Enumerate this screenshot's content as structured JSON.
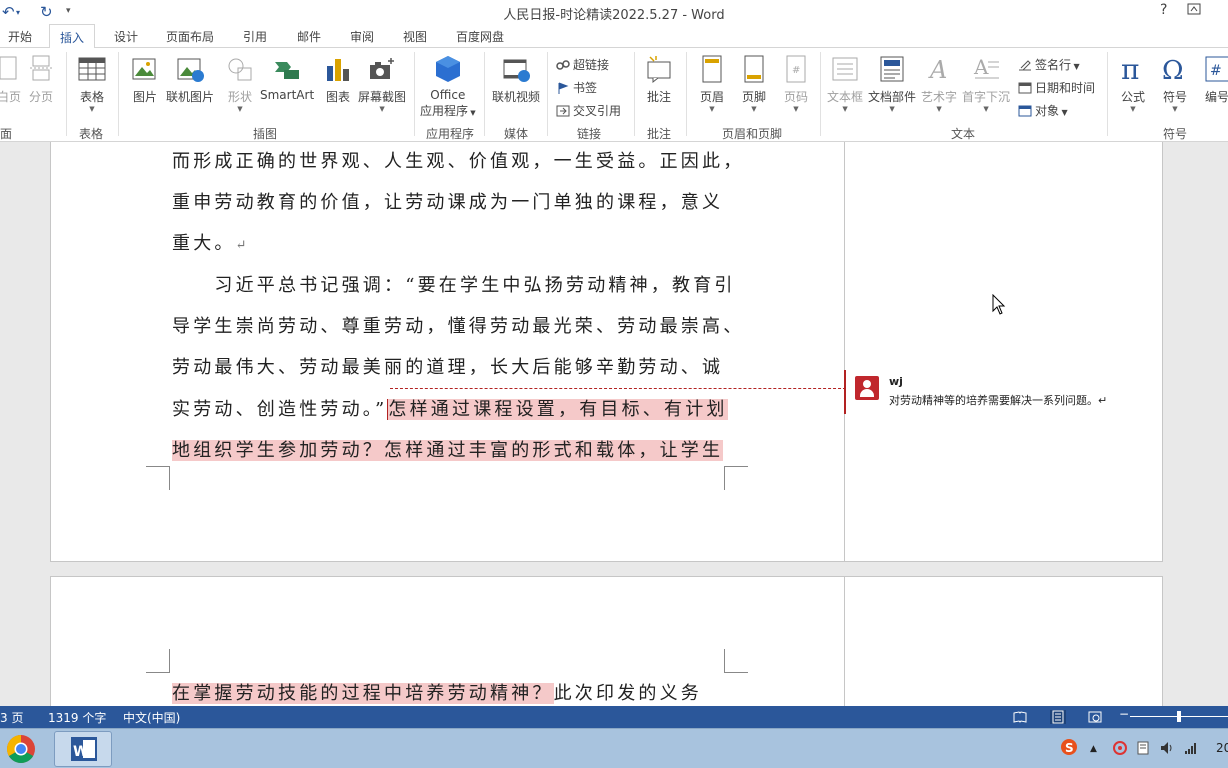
{
  "window": {
    "title": "人民日报-时论精读2022.5.27 - Word",
    "help_label": "?"
  },
  "tabs": [
    "开始",
    "插入",
    "设计",
    "页面布局",
    "引用",
    "邮件",
    "审阅",
    "视图",
    "百度网盘"
  ],
  "active_tab": "插入",
  "ribbon": {
    "pages_group": {
      "label": "面",
      "btn1": "白页",
      "btn2": "分页"
    },
    "table_group": {
      "label": "表格",
      "btn": "表格"
    },
    "illustrations_group": {
      "label": "插图",
      "buttons": [
        "图片",
        "联机图片",
        "形状",
        "SmartArt",
        "图表",
        "屏幕截图"
      ]
    },
    "apps_group": {
      "label": "应用程序",
      "btn_line1": "Office",
      "btn_line2": "应用程序"
    },
    "media_group": {
      "label": "媒体",
      "btn": "联机视频"
    },
    "links_group": {
      "label": "链接",
      "items": [
        "超链接",
        "书签",
        "交叉引用"
      ]
    },
    "comments_group": {
      "label": "批注",
      "btn": "批注"
    },
    "header_footer_group": {
      "label": "页眉和页脚",
      "buttons": [
        "页眉",
        "页脚",
        "页码"
      ]
    },
    "text_group": {
      "label": "文本",
      "buttons": [
        "文本框",
        "文档部件",
        "艺术字",
        "首字下沉"
      ],
      "small_items": [
        "签名行",
        "日期和时间",
        "对象"
      ]
    },
    "symbols_group": {
      "label": "符号",
      "buttons": [
        "公式",
        "符号",
        "编号"
      ]
    }
  },
  "document": {
    "page1_lines": [
      {
        "text": "而形成正确的世界观、人生观、价值观，一生受益。正因此，",
        "highlight": ""
      },
      {
        "text": "重申劳动教育的价值，让劳动课成为一门单独的课程，意义",
        "highlight": ""
      },
      {
        "text": "重大。",
        "highlight": "",
        "para_mark": "↵"
      },
      {
        "text": "　　习近平总书记强调：“要在学生中弘扬劳动精神，教育引",
        "highlight": ""
      },
      {
        "text": "导学生崇尚劳动、尊重劳动，懂得劳动最光荣、劳动最崇高、",
        "highlight": ""
      },
      {
        "text": "劳动最伟大、劳动最美丽的道理，长大后能够辛勤劳动、诚",
        "highlight": ""
      },
      {
        "text": "实劳动、创造性劳动。”",
        "highlight": "怎样通过课程设置，有目标、有计划"
      },
      {
        "text": "",
        "highlight": "地组织学生参加劳动？怎样通过丰富的形式和载体，让学生"
      }
    ],
    "page2_line": {
      "highlight": "在掌握劳动技能的过程中培养劳动精神？",
      "text": "此次印发的义务"
    }
  },
  "comment": {
    "author": "wj",
    "text": "对劳动精神等的培养需要解决一系列问题。↵"
  },
  "statusbar": {
    "page": "3 页",
    "word_count": "1319 个字",
    "language": "中文(中国)"
  },
  "taskbar": {
    "clock_fragment": "20"
  },
  "colors": {
    "accent": "#2b579a",
    "highlight": "#f5c9c9",
    "comment_red": "#b22222",
    "taskbar": "#a8c3de"
  }
}
